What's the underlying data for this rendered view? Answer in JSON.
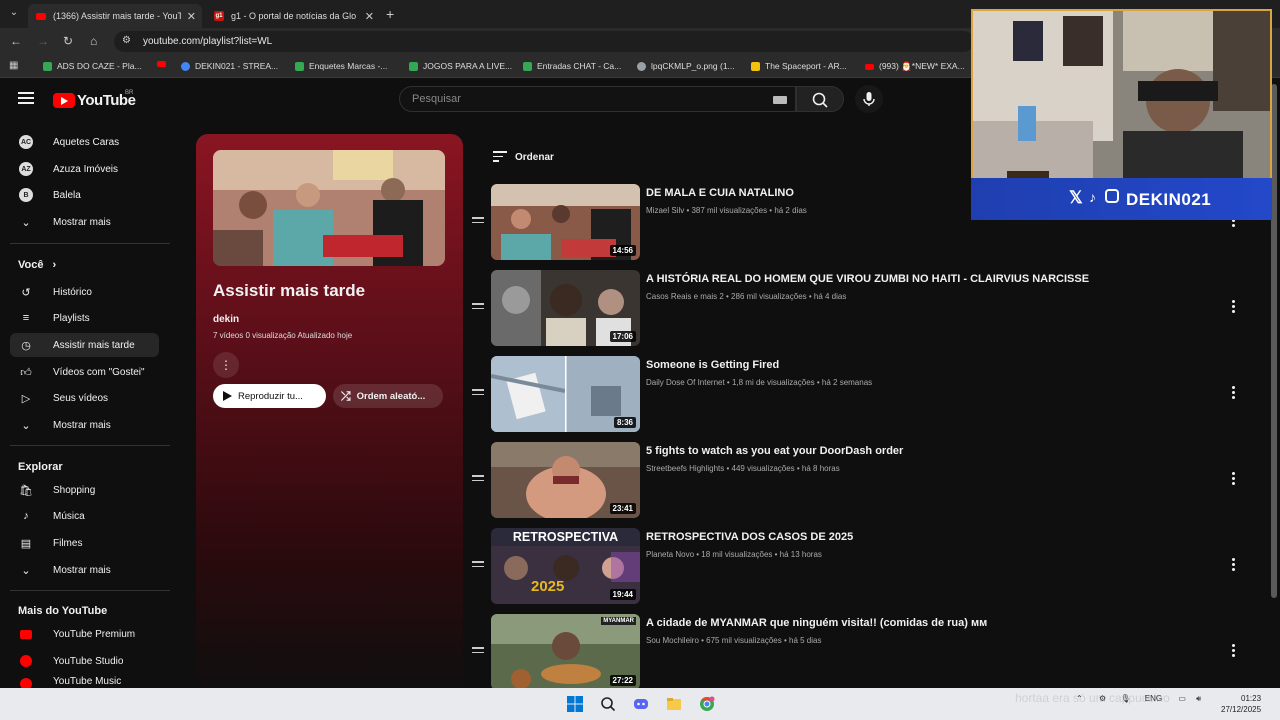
{
  "browser": {
    "tabs": [
      {
        "title": "(1366) Assistir mais tarde - YouT",
        "active": true
      },
      {
        "title": "g1 - O portal de notícias da Glo",
        "active": false
      }
    ],
    "url": "youtube.com/playlist?list=WL",
    "bookmarks": [
      {
        "label": "ADS DO CAZE - Pla...",
        "color": "#34a853"
      },
      {
        "label": "DEKIN021 - STREA...",
        "color": "#ff0000"
      },
      {
        "label": "Enquetes Marcas -...",
        "color": "#34a853"
      },
      {
        "label": "JOGOS PARA A LIVE...",
        "color": "#34a853"
      },
      {
        "label": "Entradas CHAT - Ca...",
        "color": "#34a853"
      },
      {
        "label": "lpqCKMLP_o.png (1...",
        "color": "#9aa0a6"
      },
      {
        "label": "The Spaceport - AR...",
        "color": "#f4c20d"
      },
      {
        "label": "(993) 🎅*NEW* EXA...",
        "color": "#ff0000"
      }
    ]
  },
  "youtube": {
    "logo": "YouTube",
    "region": "BR",
    "search_placeholder": "Pesquisar"
  },
  "sidebar": {
    "subscriptions": [
      {
        "label": "Aquetes Caras",
        "avatar": "AC"
      },
      {
        "label": "Azuza Imóveis",
        "avatar": "AZ"
      },
      {
        "label": "Balela",
        "avatar": "B"
      }
    ],
    "show_more_1": "Mostrar mais",
    "you_heading": "Você",
    "you_items": [
      {
        "label": "Histórico",
        "icon": "history-icon"
      },
      {
        "label": "Playlists",
        "icon": "playlists-icon"
      },
      {
        "label": "Assistir mais tarde",
        "icon": "watch-later-icon",
        "active": true
      },
      {
        "label": "Vídeos com \"Gostei\"",
        "icon": "like-icon"
      },
      {
        "label": "Seus vídeos",
        "icon": "your-videos-icon"
      }
    ],
    "show_more_2": "Mostrar mais",
    "explore_heading": "Explorar",
    "explore_items": [
      {
        "label": "Shopping",
        "icon": "shopping-icon"
      },
      {
        "label": "Música",
        "icon": "music-icon"
      },
      {
        "label": "Filmes",
        "icon": "movies-icon"
      }
    ],
    "show_more_3": "Mostrar mais",
    "more_heading": "Mais do YouTube",
    "more_items": [
      {
        "label": "YouTube Premium"
      },
      {
        "label": "YouTube Studio"
      },
      {
        "label": "YouTube Music"
      }
    ]
  },
  "playlist": {
    "title": "Assistir mais tarde",
    "owner": "dekin",
    "meta": "7 vídeos   0 visualização   Atualizado hoje",
    "play_label": "Reproduzir tu...",
    "shuffle_label": "Ordem aleató...",
    "sort_label": "Ordenar"
  },
  "videos": [
    {
      "title": "DE MALA E CUIA NATALINO",
      "meta": "Mizael Silv • 387 mil visualizações • há 2 dias",
      "duration": "14:56",
      "thumb_colors": [
        "#8a5a48",
        "#c23a3a",
        "#e6c0a8"
      ]
    },
    {
      "title": "A HISTÓRIA REAL DO HOMEM QUE VIROU ZUMBI NO HAITI - CLAIRVIUS NARCISSE",
      "meta": "Casos Reais e mais 2 • 286 mil visualizações • há 4 dias",
      "duration": "17:06",
      "thumb_colors": [
        "#5a4a3a",
        "#2a2a2a",
        "#9a8a7a"
      ]
    },
    {
      "title": "Someone is Getting Fired",
      "meta": "Daily Dose Of Internet • 1,8 mi de visualizações • há 2 semanas",
      "duration": "8:36",
      "thumb_colors": [
        "#9fb6cf",
        "#dfe6ee",
        "#5a6a7a"
      ]
    },
    {
      "title": "5 fights to watch as you eat your DoorDash order",
      "meta": "Streetbeefs Highlights • 449 visualizações • há 8 horas",
      "duration": "23:41",
      "thumb_colors": [
        "#7a5a4a",
        "#d09a80",
        "#3a2e2a"
      ]
    },
    {
      "title": "RETROSPECTIVA DOS CASOS DE 2025",
      "meta": "Planeta Novo • 18 mil visualizações • há 13 horas",
      "duration": "19:44",
      "thumb_colors": [
        "#2a2a3a",
        "#d4a020",
        "#8a4ab0"
      ],
      "thumb_text": "RETROSPECTIVA",
      "thumb_year": "2025"
    },
    {
      "title": "A cidade de MYANMAR que ninguém visita!! (comidas de rua) ᴍᴍ",
      "meta": "Sou Mochileiro • 675 mil visualizações • há 5 dias",
      "duration": "27:22",
      "thumb_colors": [
        "#6a7a5a",
        "#c08040",
        "#3a4a3a"
      ],
      "thumb_text": "MYANMAR"
    }
  ],
  "stream_overlay": {
    "handle": "DEKIN021"
  },
  "taskbar": {
    "chat_line": "hortaa  era só um cappuccino",
    "lang": "ENG",
    "time": "01:23",
    "date": "27/12/2025"
  }
}
